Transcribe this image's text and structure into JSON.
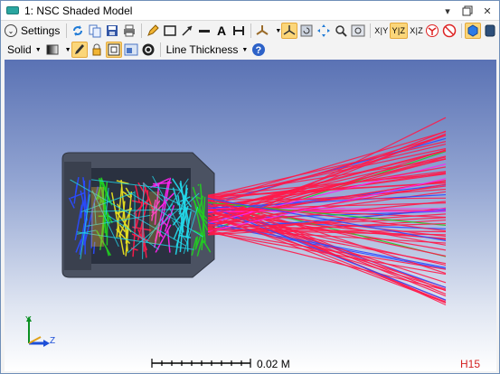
{
  "window": {
    "title": "1: NSC Shaded Model"
  },
  "toolbar": {
    "settings_label": "Settings",
    "view_xy": "X|Y",
    "view_yz": "Y|Z",
    "view_xz": "X|Z"
  },
  "toolbar2": {
    "render_mode": "Solid",
    "line_thickness": "Line Thickness"
  },
  "viewport": {
    "scale_label": "0.02 M",
    "surface_label": "H15",
    "axis_y": "Y",
    "axis_z": "Z"
  },
  "colors": {
    "ray_red": "#ff1a4a",
    "ray_blue": "#2a4bff",
    "ray_green": "#22cc22",
    "ray_magenta": "#ff22ee",
    "ray_cyan": "#22d7e8",
    "ray_yellow": "#e8e020",
    "housing": "#4b5262",
    "accent": "#f2b534"
  }
}
